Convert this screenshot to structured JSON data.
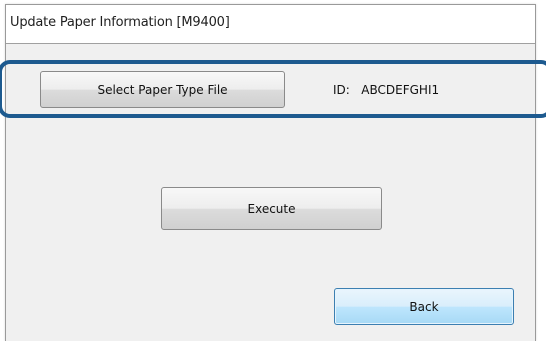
{
  "window": {
    "title": "Update Paper Information [M9400]"
  },
  "paper": {
    "select_button_label": "Select Paper Type File",
    "id_label": "ID:",
    "id_value": "ABCDEFGHI1"
  },
  "actions": {
    "execute_label": "Execute",
    "back_label": "Back"
  },
  "colors": {
    "highlight_frame": "#1d5a8f",
    "default_button_border": "#3c7fb1"
  }
}
